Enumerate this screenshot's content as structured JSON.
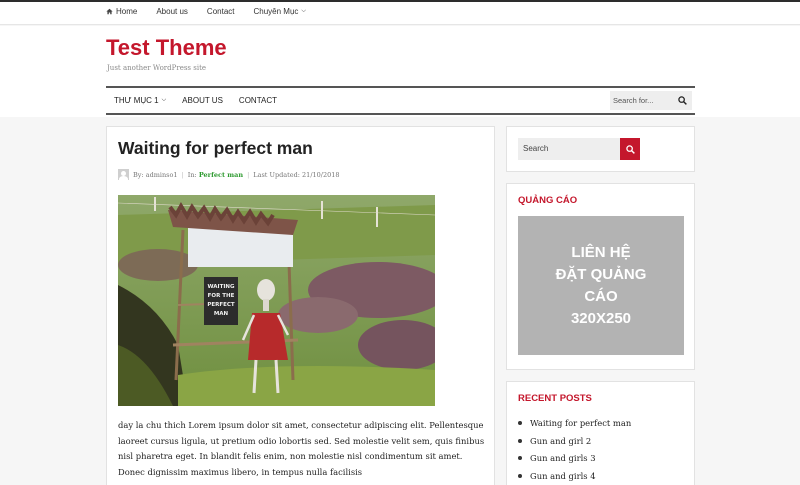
{
  "topbar": {
    "items": [
      {
        "label": "Home",
        "icon": "home-icon"
      },
      {
        "label": "About us"
      },
      {
        "label": "Contact"
      },
      {
        "label": "Chuyên Mục",
        "icon": "chevron-down-icon"
      }
    ]
  },
  "site": {
    "title": "Test Theme",
    "tagline": "Just another WordPress site"
  },
  "mainnav": {
    "items": [
      {
        "label": "THƯ MỤC 1",
        "icon": "chevron-down-icon"
      },
      {
        "label": "ABOUT US"
      },
      {
        "label": "CONTACT"
      }
    ],
    "search_placeholder": "Search for..."
  },
  "post": {
    "title": "Waiting for perfect man",
    "by_label": "By:",
    "author": "adminso1",
    "in_label": "In:",
    "category": "Perfect man",
    "updated_label": "Last Updated:",
    "updated_date": "21/10/2018",
    "sign_text": "WAITING FOR THE PERFECT MAN",
    "excerpt": "day la chu thich Lorem ipsum dolor sit amet, consectetur adipiscing elit. Pellentesque laoreet cursus ligula, ut pretium odio lobortis sed. Sed molestie velit sem, quis finibus nisl pharetra eget. In blandit felis enim, non molestie nisl condimentum sit amet. Donec dignissim maximus libero, in tempus nulla facilisis"
  },
  "sidebar": {
    "search_placeholder": "Search",
    "ad": {
      "title": "QUẢNG CÁO",
      "line1": "LIÊN HỆ",
      "line2": "ĐẶT QUẢNG",
      "line3": "CÁO",
      "line4": "320X250"
    },
    "recent": {
      "title": "RECENT POSTS",
      "items": [
        "Waiting for perfect man",
        "Gun and girl 2",
        "Gun and girls 3",
        "Gun and girls 4"
      ]
    }
  },
  "colors": {
    "brand_red": "#c4172c",
    "category_green": "#2d9a2f",
    "ad_gray": "#b3b3b3"
  }
}
